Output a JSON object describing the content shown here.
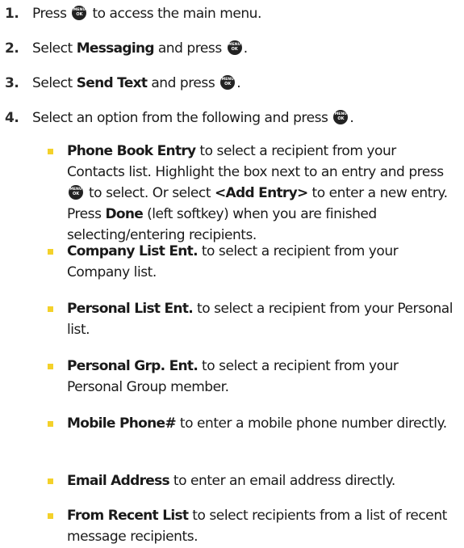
{
  "icons": {
    "menu_ok_key": "menu-ok-key-icon"
  },
  "colors": {
    "bullet": "#f4d12a",
    "text": "#1a1a1a"
  },
  "steps": [
    {
      "number": "1.",
      "pre": "Press",
      "post": "to access the main menu."
    },
    {
      "number": "2.",
      "pre": "Select",
      "bold": "Messaging",
      "post": "and press",
      "end": "."
    },
    {
      "number": "3.",
      "pre": "Select",
      "bold": "Send Text",
      "post": "and press",
      "end": "."
    },
    {
      "number": "4.",
      "text": "Select an option from the following and press",
      "end": "."
    }
  ],
  "options": [
    {
      "bold": "Phone Book Entry",
      "text1": "to select a recipient from your Contacts list. Highlight the box next to an entry and press",
      "text2": "to select. Or select",
      "bold2": "<Add Entry>",
      "text3": "to enter a new entry. Press",
      "bold3": "Done",
      "text4": "(left softkey) when you are finished selecting/entering recipients."
    },
    {
      "bold": "Company List Ent.",
      "text": "to select a recipient from your Company list."
    },
    {
      "bold": "Personal List Ent.",
      "text": "to select a recipient from your Personal list."
    },
    {
      "bold": "Personal Grp. Ent.",
      "text": "to select a recipient from your Personal Group member."
    },
    {
      "bold": "Mobile Phone#",
      "text": "to enter a mobile phone number directly."
    },
    {
      "bold": "Email Address",
      "text": "to enter an email address directly."
    },
    {
      "bold": "From Recent List",
      "text": "to select recipients from a list of recent message recipients."
    }
  ]
}
